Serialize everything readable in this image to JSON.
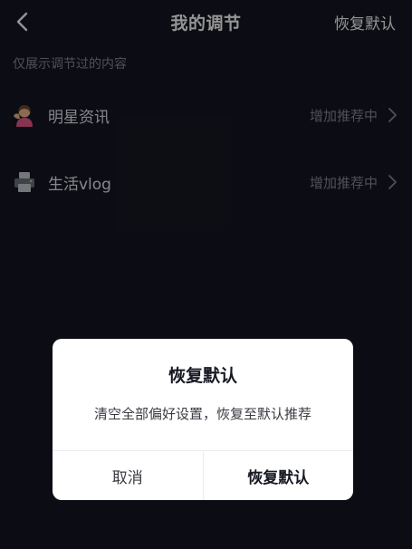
{
  "header": {
    "title": "我的调节",
    "reset_label": "恢复默认"
  },
  "subtitle": "仅展示调节过的内容",
  "items": [
    {
      "label": "明星资讯",
      "action": "增加推荐中",
      "icon": "person-with-hand-icon"
    },
    {
      "label": "生活vlog",
      "action": "增加推荐中",
      "icon": "printer-icon"
    }
  ],
  "dialog": {
    "title": "恢复默认",
    "message": "清空全部偏好设置，恢复至默认推荐",
    "cancel_label": "取消",
    "confirm_label": "恢复默认"
  },
  "colors": {
    "background": "#161823",
    "dialog_background": "#ffffff",
    "muted_text": "#8a8b92"
  }
}
